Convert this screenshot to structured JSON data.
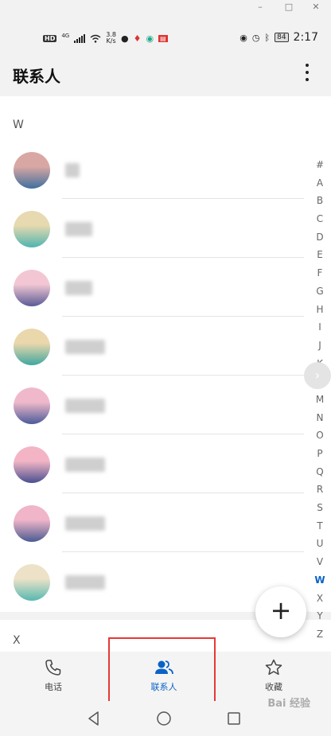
{
  "window": {
    "minimize": "–",
    "maximize": "□",
    "close": "✕"
  },
  "status_bar": {
    "hd": "HD",
    "network": "4G",
    "speed_value": "3.8",
    "speed_unit": "K/s",
    "battery": "84",
    "time": "2:17"
  },
  "header": {
    "title": "联系人"
  },
  "contacts": {
    "sections": [
      {
        "letter": "W"
      },
      {
        "letter": "X"
      }
    ],
    "items": [
      {
        "avatar_colors": [
          "#d9a7a3",
          "#3f6f9e"
        ]
      },
      {
        "avatar_colors": [
          "#e7d9b0",
          "#4fb4b0"
        ]
      },
      {
        "avatar_colors": [
          "#f2c7d3",
          "#5a5a96"
        ]
      },
      {
        "avatar_colors": [
          "#ead7ac",
          "#3fa79f"
        ]
      },
      {
        "avatar_colors": [
          "#f0b9cb",
          "#4a5a99"
        ]
      },
      {
        "avatar_colors": [
          "#f3b5c6",
          "#4a4f8f"
        ]
      },
      {
        "avatar_colors": [
          "#f0b5c8",
          "#4a5a92"
        ]
      },
      {
        "avatar_colors": [
          "#ede2c8",
          "#56b8b0"
        ]
      }
    ]
  },
  "index_bar": {
    "letters": [
      "#",
      "A",
      "B",
      "C",
      "D",
      "E",
      "F",
      "G",
      "H",
      "I",
      "J",
      "K",
      "L",
      "M",
      "N",
      "O",
      "P",
      "Q",
      "R",
      "S",
      "T",
      "U",
      "V",
      "W",
      "X",
      "Y",
      "Z"
    ],
    "active": "W"
  },
  "fab": {
    "label": "+"
  },
  "tabs": [
    {
      "label": "电话",
      "icon": "phone-icon"
    },
    {
      "label": "联系人",
      "icon": "contacts-icon",
      "active": true
    },
    {
      "label": "收藏",
      "icon": "star-icon"
    }
  ],
  "watermark": "Bai 经验",
  "colors": {
    "accent": "#0a63c6",
    "highlight": "#e53935"
  }
}
